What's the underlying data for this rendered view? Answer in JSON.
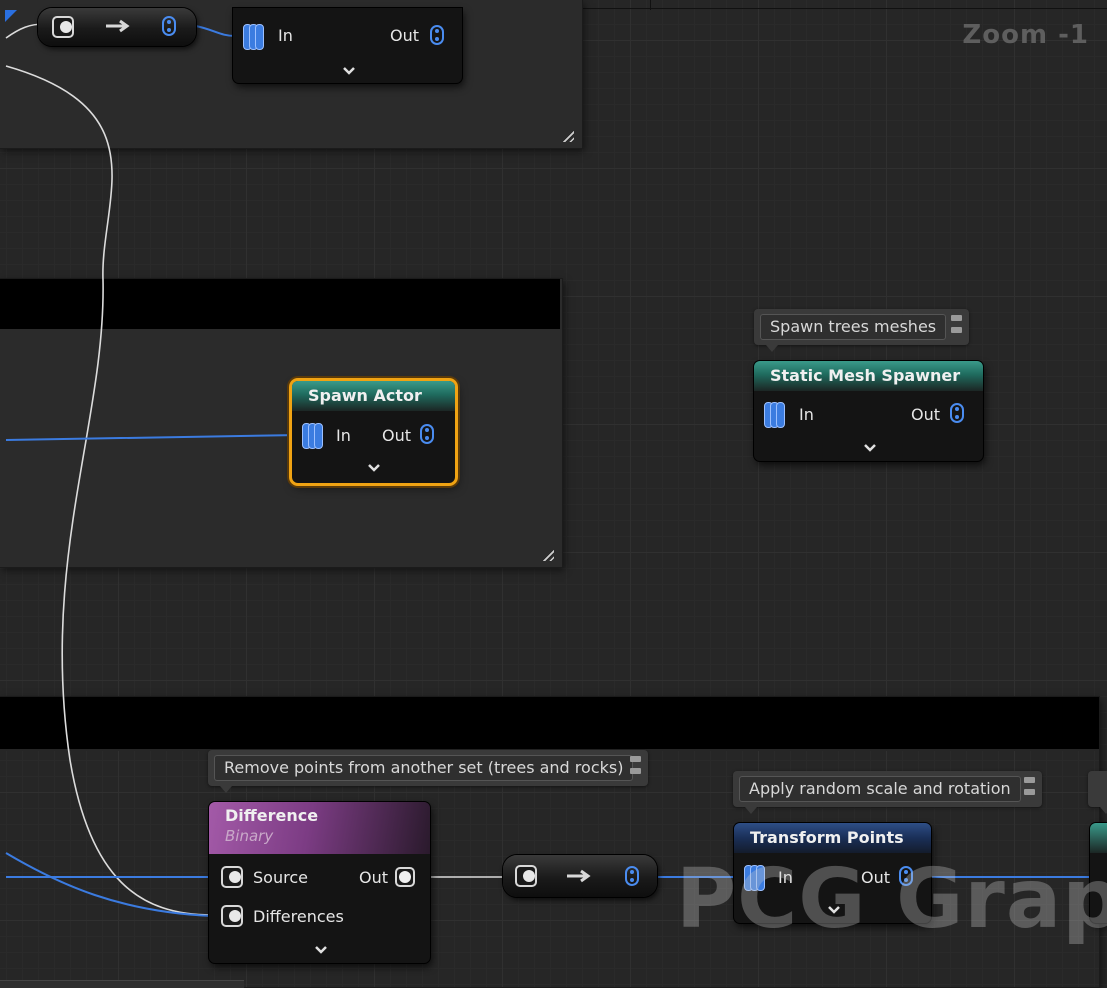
{
  "zoom_label": "Zoom -1",
  "watermark": "PCG Graph",
  "nodes": {
    "top_partial": {
      "in_label": "In",
      "out_label": "Out"
    },
    "spawn_actor": {
      "title": "Spawn Actor",
      "in_label": "In",
      "out_label": "Out"
    },
    "static_mesh_spawner": {
      "title": "Static Mesh Spawner",
      "in_label": "In",
      "out_label": "Out",
      "comment": "Spawn trees meshes"
    },
    "difference": {
      "title": "Difference",
      "subtitle": "Binary",
      "source_label": "Source",
      "differences_label": "Differences",
      "out_label": "Out",
      "comment": "Remove points from another set (trees and rocks)"
    },
    "transform_points": {
      "title": "Transform Points",
      "in_label": "In",
      "out_label": "Out",
      "comment": "Apply random scale and rotation"
    }
  },
  "colors": {
    "wire_blue": "#3b7be0",
    "wire_white": "#dcdcdc",
    "selection": "#f0a313",
    "teal_header": "#2a8a7a",
    "blue_header": "#23406f",
    "purple_header": "#8e4a94"
  }
}
